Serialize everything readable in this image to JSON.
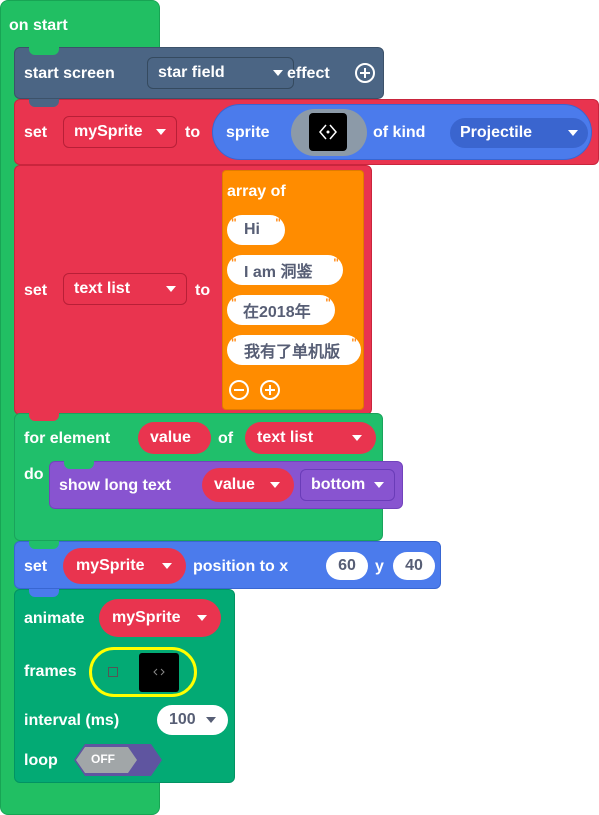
{
  "on_start": {
    "label": "on start"
  },
  "start_screen": {
    "label": "start screen",
    "effect_value": "star field",
    "suffix": "effect"
  },
  "set_sprite": {
    "set_label": "set",
    "variable": "mySprite",
    "to_label": "to",
    "sprite_label": "sprite",
    "kind_label": "of kind",
    "kind_value": "Projectile"
  },
  "set_text_list": {
    "set_label": "set",
    "variable": "text list",
    "to_label": "to",
    "array_label": "array of",
    "items": [
      "Hi",
      "I am 洞鉴",
      "在2018年",
      "我有了单机版"
    ]
  },
  "for_element": {
    "label": "for element",
    "var": "value",
    "of_label": "of",
    "list": "text list",
    "do_label": "do"
  },
  "show_long_text": {
    "label": "show long text",
    "value": "value",
    "position": "bottom"
  },
  "set_position": {
    "set_label": "set",
    "sprite": "mySprite",
    "label": "position to x",
    "x": "60",
    "y_label": "y",
    "y": "40"
  },
  "animate": {
    "label": "animate",
    "sprite": "mySprite",
    "frames_label": "frames",
    "interval_label": "interval (ms)",
    "interval": "100",
    "loop_label": "loop",
    "loop_value": "OFF"
  },
  "colors": {
    "events": "#21bf63",
    "scene": "#4b6584",
    "variables": "#e9344f",
    "arrays": "#ff8c00",
    "loops": "#20bf6b",
    "game": "#8854d0",
    "sprites": "#4b7bec",
    "animation": "#03aa74",
    "highlight": "#ffff00"
  }
}
